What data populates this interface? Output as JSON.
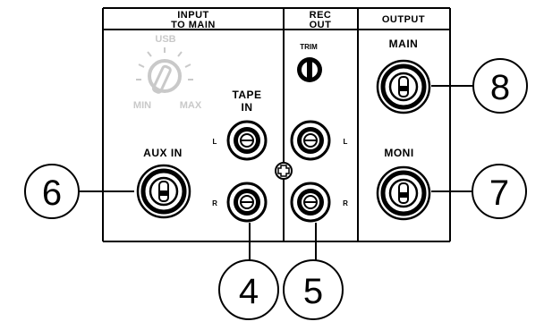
{
  "panel": {
    "sections": {
      "input_to_main": {
        "line1": "INPUT",
        "line2": "TO MAIN"
      },
      "rec_out": {
        "line1": "REC",
        "line2": "OUT"
      },
      "output": {
        "label": "OUTPUT"
      }
    },
    "usb_knob": {
      "label": "USB",
      "min": "MIN",
      "max": "MAX"
    },
    "tape_in": {
      "line1": "TAPE",
      "line2": "IN"
    },
    "trim": "TRIM",
    "aux_in": "AUX IN",
    "main": "MAIN",
    "moni": "MONI",
    "channel_left": "L",
    "channel_right": "R"
  },
  "callouts": {
    "aux_in": "6",
    "tape_in": "4",
    "rec_out": "5",
    "main_out": "8",
    "moni_out": "7"
  },
  "colors": {
    "ink": "#000000",
    "faint": "#c9c9c9",
    "background": "#ffffff"
  }
}
